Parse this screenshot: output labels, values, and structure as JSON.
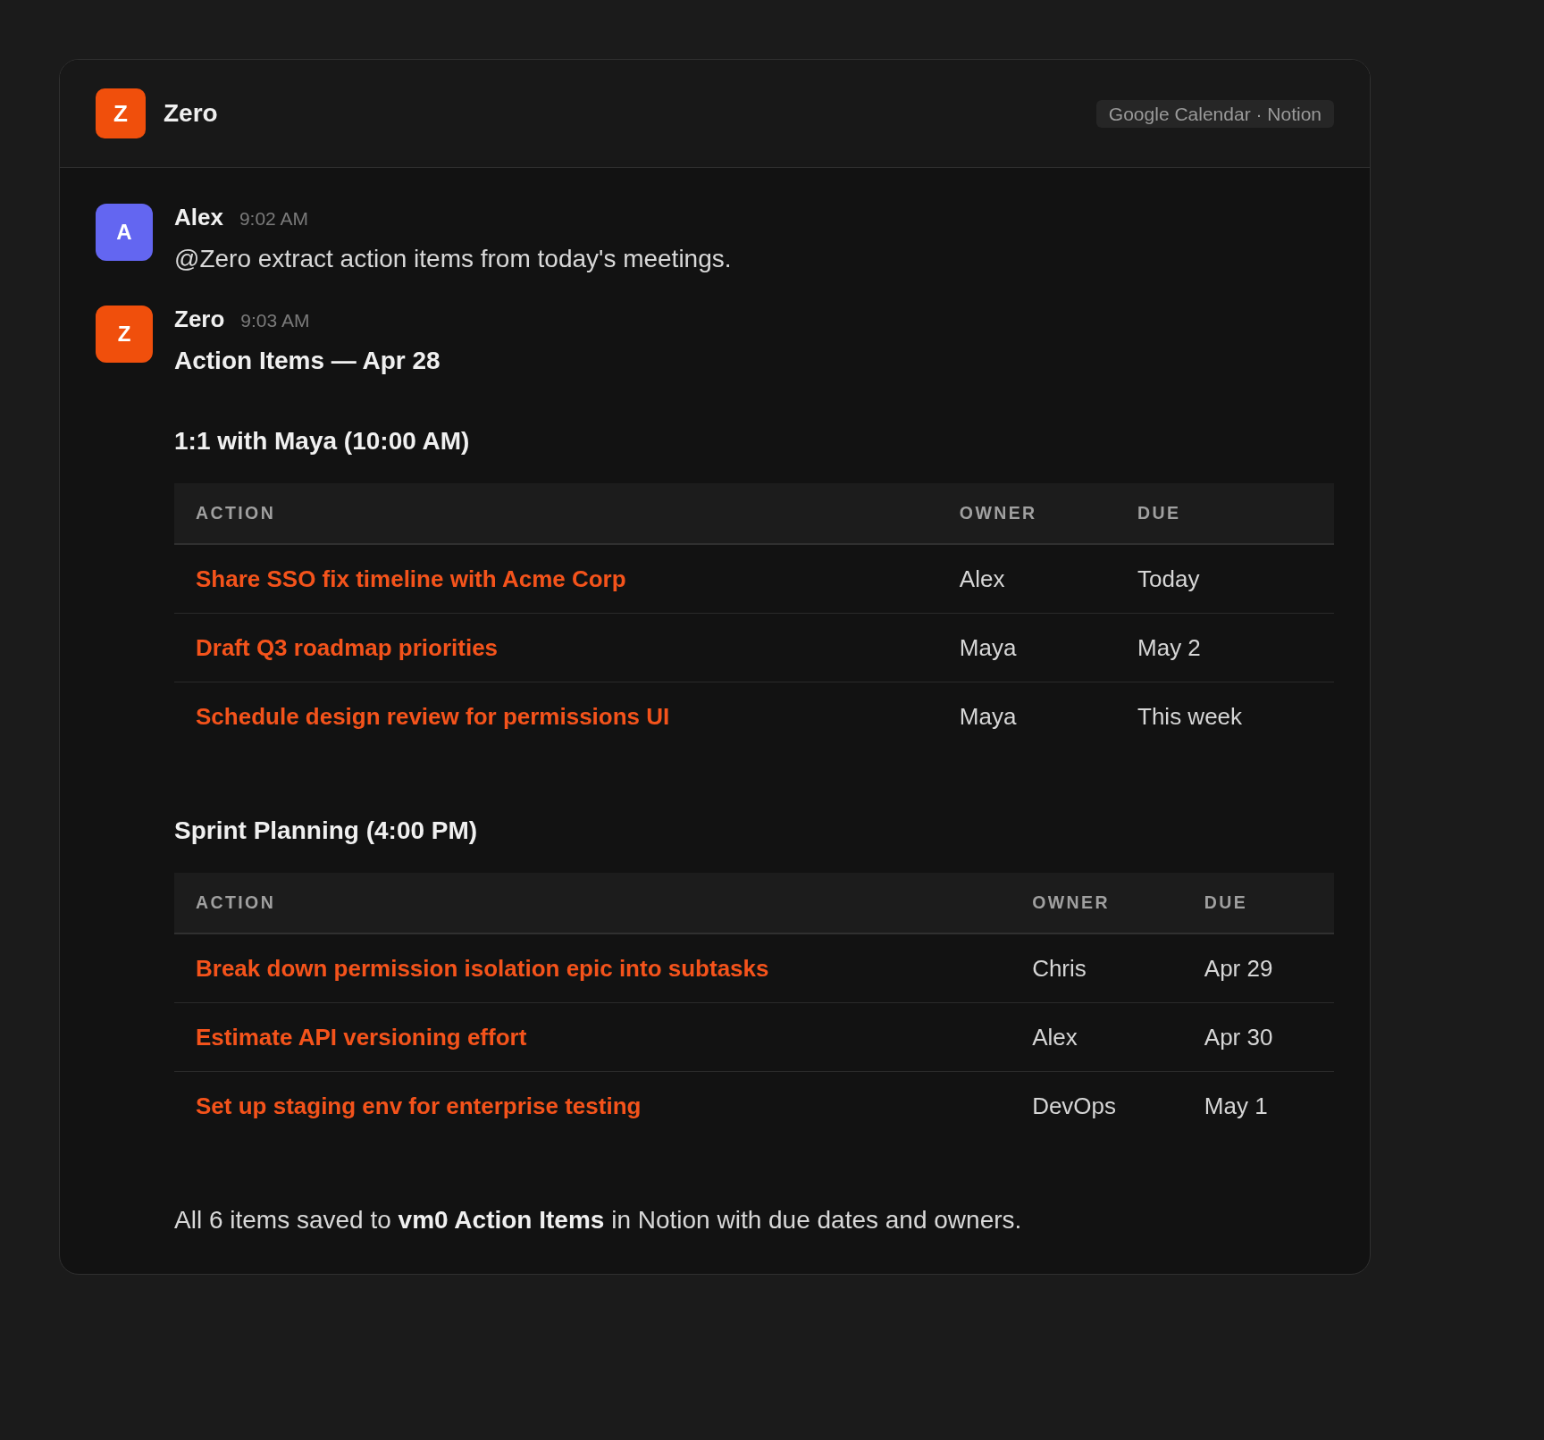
{
  "header": {
    "logo_letter": "Z",
    "title": "Zero",
    "integrations": "Google Calendar · Notion"
  },
  "messages": [
    {
      "kind": "text",
      "avatar_letter": "A",
      "color": "#6366f1",
      "author": "Alex",
      "time": "9:02 AM",
      "text": "@Zero extract action items from today's meetings."
    },
    {
      "kind": "report",
      "avatar_letter": "Z",
      "color": "#f04f0c",
      "author": "Zero",
      "time": "9:03 AM",
      "title": "Action Items — Apr 28",
      "sections": [
        {
          "heading": "1:1 with Maya (10:00 AM)",
          "table": {
            "columns": [
              "ACTION",
              "OWNER",
              "DUE"
            ],
            "rows": [
              {
                "action": "Share SSO fix timeline with Acme Corp",
                "owner": "Alex",
                "due": "Today"
              },
              {
                "action": "Draft Q3 roadmap priorities",
                "owner": "Maya",
                "due": "May 2"
              },
              {
                "action": "Schedule design review for permissions UI",
                "owner": "Maya",
                "due": "This week"
              }
            ]
          }
        },
        {
          "heading": "Sprint Planning (4:00 PM)",
          "table": {
            "columns": [
              "ACTION",
              "OWNER",
              "DUE"
            ],
            "rows": [
              {
                "action": "Break down permission isolation epic into subtasks",
                "owner": "Chris",
                "due": "Apr 29"
              },
              {
                "action": "Estimate API versioning effort",
                "owner": "Alex",
                "due": "Apr 30"
              },
              {
                "action": "Set up staging env for enterprise testing",
                "owner": "DevOps",
                "due": "May 1"
              }
            ]
          }
        }
      ],
      "footer": "All 6 items saved to **vm0 Action Items** in Notion with due dates and owners."
    }
  ]
}
